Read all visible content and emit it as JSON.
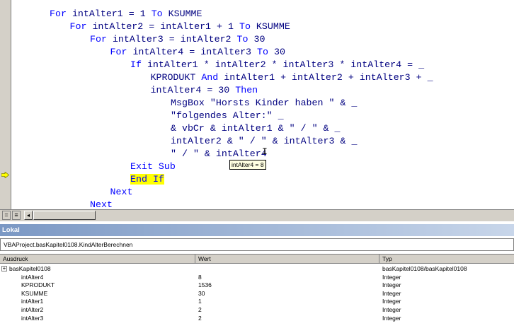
{
  "editor": {
    "lines": [
      {
        "text": "For intAlter1 = 1 To KSUMME",
        "level": 0
      },
      {
        "text": "For intAlter2 = intAlter1 + 1 To KSUMME",
        "level": 1
      },
      {
        "text": "For intAlter3 = intAlter2 To 30",
        "level": 2
      },
      {
        "text": "For intAlter4 = intAlter3 To 30",
        "level": 3
      },
      {
        "text": "If intAlter1 * intAlter2 * intAlter3 * intAlter4 = _",
        "level": 4
      },
      {
        "text": "KPRODUKT And intAlter1 + intAlter2 + intAlter3 + _",
        "level": 5
      },
      {
        "text": "intAlter4 = 30 Then",
        "level": 5
      },
      {
        "text": "MsgBox \"Horsts Kinder haben \" & _",
        "level": 6
      },
      {
        "text": "\"folgendes Alter:\" _",
        "level": 6
      },
      {
        "text": "& vbCr & intAlter1 & \" / \" & _",
        "level": 6
      },
      {
        "text": "intAlter2 & \" / \" & intAlter3 & _",
        "level": 6
      },
      {
        "text": "\" / \" & intAlter4",
        "level": 6
      },
      {
        "text": "Exit Sub",
        "level": 4
      },
      {
        "text": "End If",
        "level": 4,
        "highlight": true
      },
      {
        "text": "Next",
        "level": 3
      },
      {
        "text": "Next",
        "level": 2
      }
    ],
    "keywords": [
      "For",
      "To",
      "If",
      "And",
      "Then",
      "Exit",
      "Sub",
      "End",
      "Next"
    ],
    "tooltip": "intAlter4 = 8",
    "execution_arrow_icon": "arrow-right-icon",
    "colors": {
      "keyword": "#0000ff",
      "text": "#000080",
      "highlight": "#ffff00"
    }
  },
  "locals": {
    "title": "Lokal",
    "context": "VBAProject.basKapitel0108.KindAlterBerechnen",
    "columns": [
      "Ausdruck",
      "Wert",
      "Typ"
    ],
    "rows": [
      {
        "expr": "basKapitel0108",
        "value": "",
        "type": "basKapitel0108/basKapitel0108",
        "expandable": true
      },
      {
        "expr": "intAlter4",
        "value": "8",
        "type": "Integer"
      },
      {
        "expr": "KPRODUKT",
        "value": "1536",
        "type": "Integer"
      },
      {
        "expr": "KSUMME",
        "value": "30",
        "type": "Integer"
      },
      {
        "expr": "intAlter1",
        "value": "1",
        "type": "Integer"
      },
      {
        "expr": "intAlter2",
        "value": "2",
        "type": "Integer"
      },
      {
        "expr": "intAlter3",
        "value": "2",
        "type": "Integer"
      }
    ]
  }
}
